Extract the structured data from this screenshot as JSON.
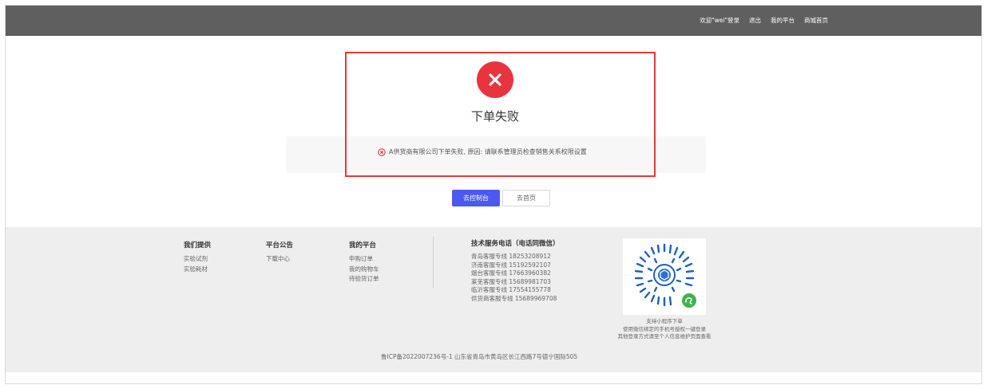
{
  "topnav": {
    "welcome": "欢迎\"wei\"登录",
    "logout": "退出",
    "my_platform": "我的平台",
    "mall_home": "商城首页"
  },
  "result": {
    "title": "下单失败",
    "reason": "A供货商有限公司下单失败, 原因: 请联系管理员检查销售关系权限设置",
    "status_color": "#e8343c",
    "highlight_color": "#e63a3a"
  },
  "actions": {
    "console_label": "去控制台",
    "home_label": "去首页",
    "primary_color": "#4b59f0"
  },
  "footer": {
    "provide": {
      "title": "我们提供",
      "links": [
        "实验试剂",
        "实验耗材"
      ]
    },
    "notice": {
      "title": "平台公告",
      "links": [
        "下载中心"
      ]
    },
    "platform": {
      "title": "我的平台",
      "links": [
        "申购订单",
        "我的购物车",
        "待验货订单"
      ]
    },
    "service": {
      "title": "技术服务电话（电话同微信）",
      "lines": [
        "青岛客服专线   18253208912",
        "济南客服专线   15192592107",
        "烟台客服专线   17663960382",
        "莱芜客服专线   15689981703",
        "临沂客服专线   17554155778",
        "供货商客服专线 15689969708"
      ]
    },
    "qr": {
      "captions": [
        "支持小程序下单",
        "使用微信绑定的手机号授权一键登录",
        "其他登录方式请至个人信息维护页面查看"
      ]
    },
    "icp": "鲁ICP备2022007236号-1  山东省青岛市黄岛区长江西路7号德宁国际505"
  }
}
